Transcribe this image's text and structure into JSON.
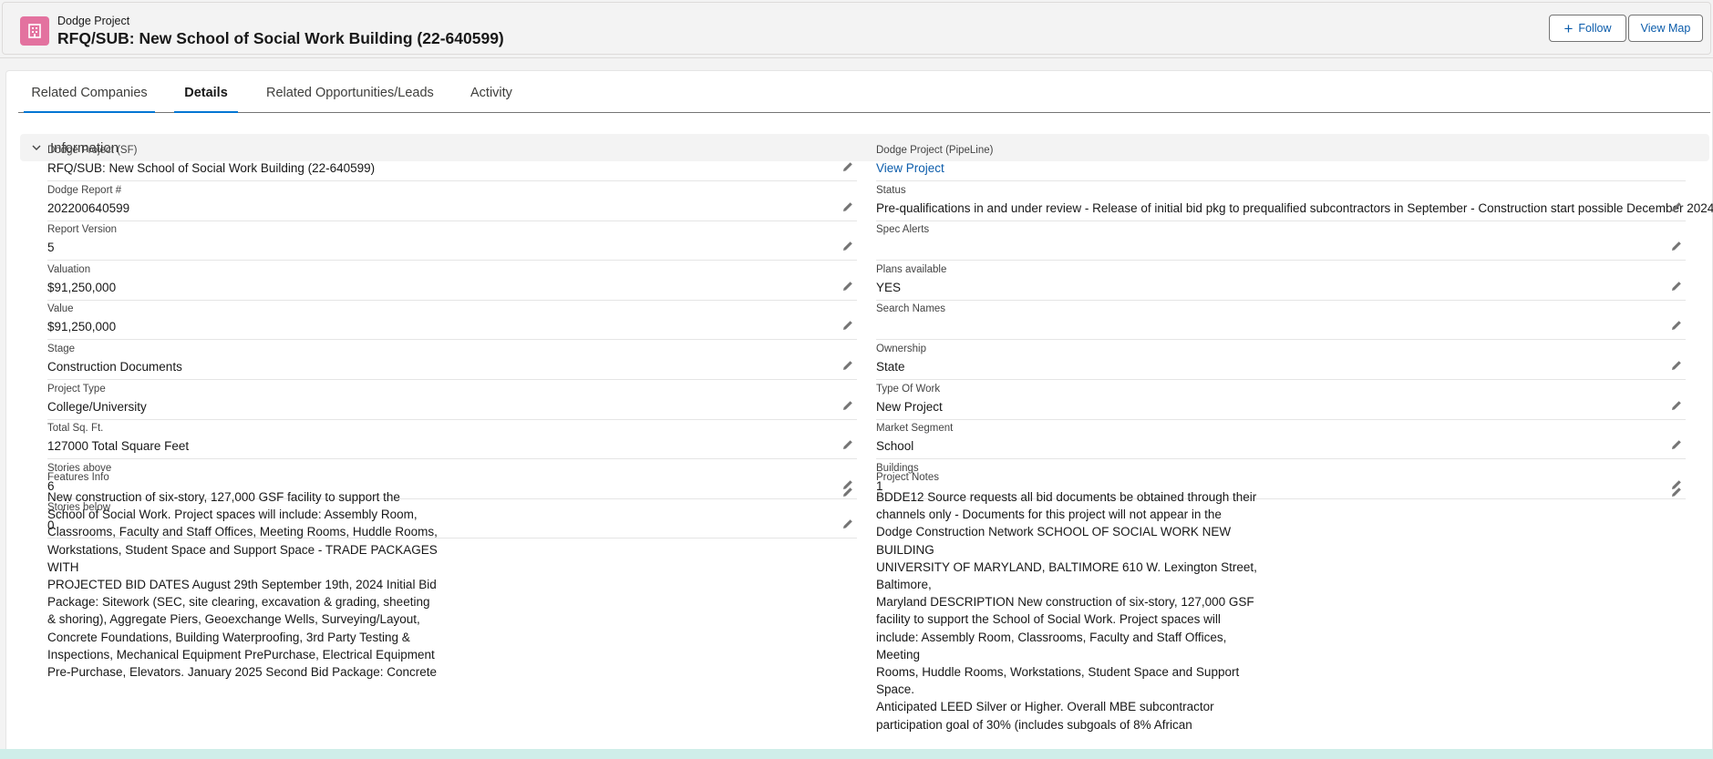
{
  "header": {
    "object_type": "Dodge Project",
    "title": "RFQ/SUB: New School of Social Work Building (22-640599)",
    "follow_label": "Follow",
    "view_map_label": "View Map",
    "icon": "building-icon",
    "icon_color": "#e3729f"
  },
  "tabs": [
    {
      "label": "Related Companies"
    },
    {
      "label": "Details"
    },
    {
      "label": "Related Opportunities/Leads"
    },
    {
      "label": "Activity"
    }
  ],
  "active_tab": "Details",
  "section": {
    "label": "Information"
  },
  "left_fields": [
    {
      "label": "Dodge Project (SF)",
      "value": "RFQ/SUB: New School of Social Work Building (22-640599)"
    },
    {
      "label": "Dodge Report #",
      "value": "202200640599"
    },
    {
      "label": "Report Version",
      "value": "5"
    },
    {
      "label": "Valuation",
      "value": "$91,250,000"
    },
    {
      "label": "Value",
      "value": "$91,250,000"
    },
    {
      "label": "Stage",
      "value": "Construction Documents"
    },
    {
      "label": "Project Type",
      "value": "College/University"
    },
    {
      "label": "Total Sq. Ft.",
      "value": "127000 Total Square Feet"
    },
    {
      "label": "Stories above",
      "value": "6"
    },
    {
      "label": "Stories below",
      "value": "0"
    }
  ],
  "right_fields": [
    {
      "label": "Dodge Project (PipeLine)",
      "value": "View Project"
    },
    {
      "label": "Status",
      "value": "Pre-qualifications in and under review - Release of initial bid pkg to prequalified subcontractors in September - Construction start possible December 2024"
    },
    {
      "label": "Spec Alerts",
      "value": ""
    },
    {
      "label": "Plans available",
      "value": "YES"
    },
    {
      "label": "Search Names",
      "value": ""
    },
    {
      "label": "Ownership",
      "value": "State"
    },
    {
      "label": "Type Of Work",
      "value": "New Project"
    },
    {
      "label": "Market Segment",
      "value": "School"
    },
    {
      "label": "Buildings",
      "value": "1"
    }
  ],
  "features_info": {
    "label": "Features Info",
    "lines": [
      "New construction of six-story, 127,000 GSF facility to support the",
      "School of Social Work. Project spaces will include: Assembly Room,",
      "Classrooms, Faculty and Staff Offices, Meeting Rooms, Huddle Rooms,",
      "Workstations, Student Space and Support Space - TRADE PACKAGES WITH",
      "PROJECTED BID DATES August 29th September 19th, 2024 Initial Bid",
      "Package: Sitework (SEC, site clearing, excavation & grading, sheeting",
      "& shoring), Aggregate Piers, Geoexchange Wells, Surveying/Layout,",
      "Concrete Foundations, Building Waterproofing, 3rd Party Testing &",
      "Inspections, Mechanical Equipment PrePurchase, Electrical Equipment",
      "Pre-Purchase, Elevators. January 2025 Second Bid Package: Concrete"
    ]
  },
  "project_notes": {
    "label": "Project Notes",
    "lines": [
      "BDDE12 Source requests all bid documents be obtained through their",
      "channels only - Documents for this project will not appear in the",
      "Dodge Construction Network SCHOOL OF SOCIAL WORK NEW BUILDING",
      "UNIVERSITY OF MARYLAND, BALTIMORE 610 W. Lexington Street, Baltimore,",
      "Maryland DESCRIPTION New construction of six-story, 127,000 GSF",
      "facility to support the School of Social Work. Project spaces will",
      "include: Assembly Room, Classrooms, Faculty and Staff Offices, Meeting",
      "Rooms, Huddle Rooms, Workstations, Student Space and Support Space.",
      "Anticipated LEED Silver or Higher. Overall MBE subcontractor",
      "participation goal of 30% (includes subgoals of 8% African"
    ]
  }
}
